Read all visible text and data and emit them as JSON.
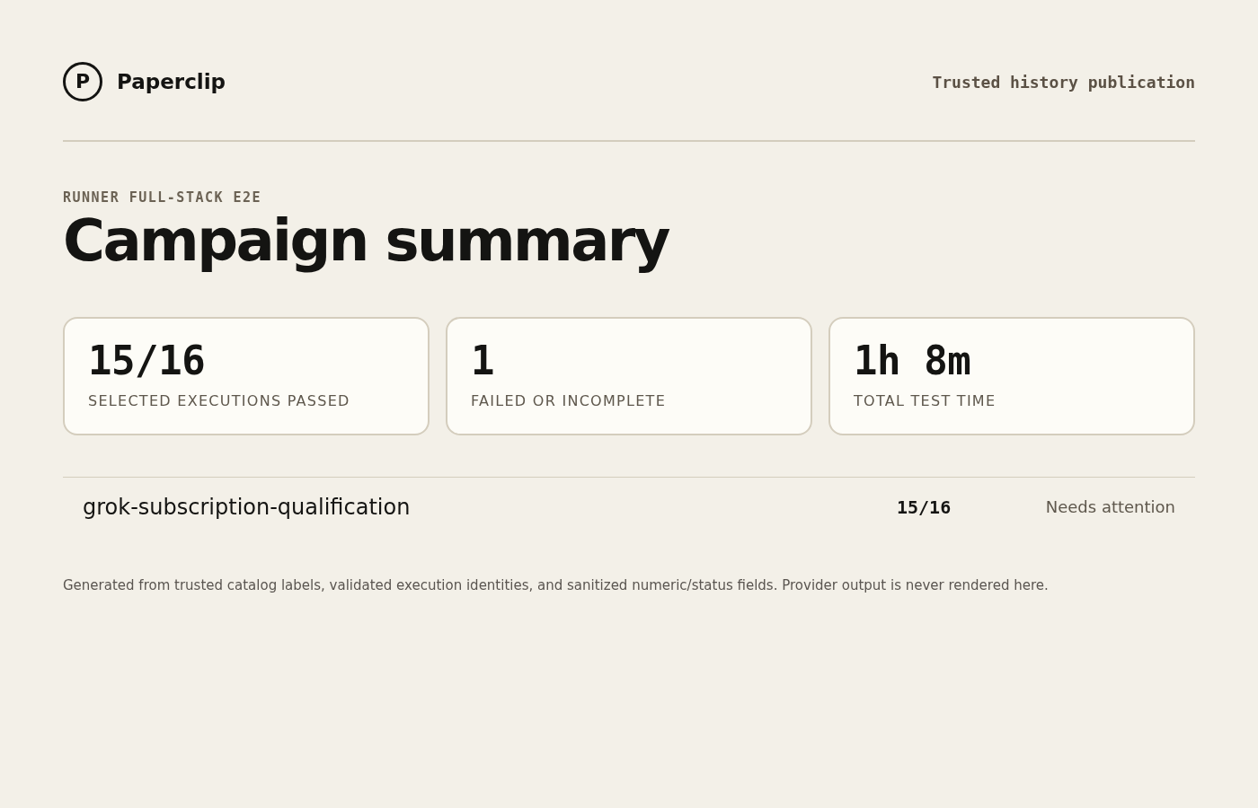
{
  "header": {
    "logo": {
      "mark": "P",
      "name": "Paperclip"
    },
    "tagline": "Trusted history publication"
  },
  "eyebrow": "RUNNER FULL-STACK E2E",
  "title": "Campaign summary",
  "stats": [
    {
      "value": "15/16",
      "label": "SELECTED EXECUTIONS PASSED"
    },
    {
      "value": "1",
      "label": "FAILED OR INCOMPLETE"
    },
    {
      "value": "1h 8m",
      "label": "TOTAL TEST TIME"
    }
  ],
  "campaigns": [
    {
      "name": "grok-subscription-qualification",
      "score": "15/16",
      "status": "Needs attention"
    }
  ],
  "footnote": "Generated from trusted catalog labels, validated execution identities, and sanitized numeric/status fields. Provider output is never rendered here."
}
